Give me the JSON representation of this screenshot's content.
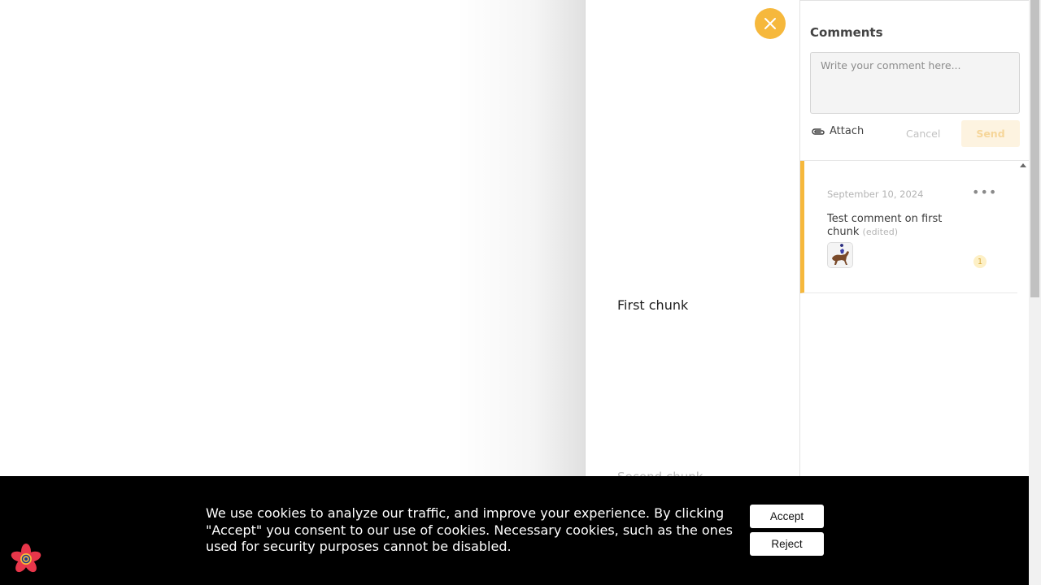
{
  "document": {
    "first_chunk": "First chunk",
    "second_chunk": "Second chunk"
  },
  "close_button": {
    "icon": "close-icon",
    "color": "#f6b83c"
  },
  "comments": {
    "title": "Comments",
    "input_placeholder": "Write your comment here...",
    "attach_label": "Attach",
    "attach_icon": "paperclip-icon",
    "cancel_label": "Cancel",
    "send_label": "Send",
    "items": [
      {
        "date": "September 10, 2024",
        "text": "Test comment on first chunk",
        "edited_label": "(edited)",
        "reply_count": "1",
        "more_icon": "more-horizontal-icon",
        "avatar_icon": "horse-avatar-icon"
      }
    ]
  },
  "cookie_banner": {
    "text": "We use cookies to analyze our traffic, and improve your experience. By clicking \"Accept\" you consent to our use of cookies. Necessary cookies, such as the ones used for security purposes cannot be disabled.",
    "accept_label": "Accept",
    "reject_label": "Reject"
  },
  "colors": {
    "accent": "#f6b83c",
    "banner_background": "#000000"
  }
}
